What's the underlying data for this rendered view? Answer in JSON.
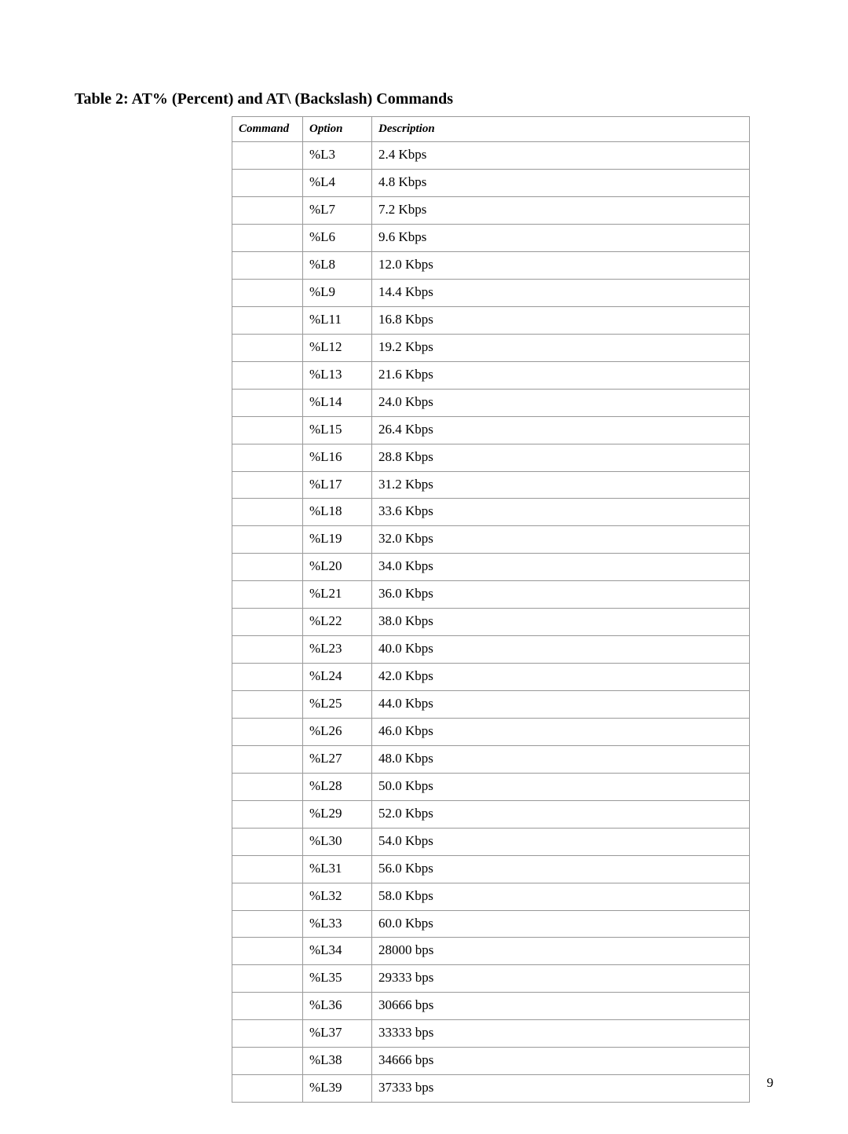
{
  "title": "Table 2: AT% (Percent) and AT\\ (Backslash) Commands",
  "headers": {
    "command": "Command",
    "option": "Option",
    "description": "Description"
  },
  "rows": [
    {
      "command": "",
      "option": "%L3",
      "description": "2.4 Kbps"
    },
    {
      "command": "",
      "option": "%L4",
      "description": "4.8 Kbps"
    },
    {
      "command": "",
      "option": "%L7",
      "description": "7.2 Kbps"
    },
    {
      "command": "",
      "option": "%L6",
      "description": "9.6 Kbps"
    },
    {
      "command": "",
      "option": "%L8",
      "description": "12.0 Kbps"
    },
    {
      "command": "",
      "option": "%L9",
      "description": "14.4 Kbps"
    },
    {
      "command": "",
      "option": "%L11",
      "description": "16.8 Kbps"
    },
    {
      "command": "",
      "option": "%L12",
      "description": "19.2 Kbps"
    },
    {
      "command": "",
      "option": "%L13",
      "description": "21.6 Kbps"
    },
    {
      "command": "",
      "option": "%L14",
      "description": "24.0 Kbps"
    },
    {
      "command": "",
      "option": "%L15",
      "description": "26.4 Kbps"
    },
    {
      "command": "",
      "option": "%L16",
      "description": "28.8 Kbps"
    },
    {
      "command": "",
      "option": "%L17",
      "description": "31.2 Kbps"
    },
    {
      "command": "",
      "option": "%L18",
      "description": "33.6 Kbps"
    },
    {
      "command": "",
      "option": "%L19",
      "description": "32.0 Kbps"
    },
    {
      "command": "",
      "option": "%L20",
      "description": "34.0 Kbps"
    },
    {
      "command": "",
      "option": "%L21",
      "description": "36.0 Kbps"
    },
    {
      "command": "",
      "option": "%L22",
      "description": "38.0 Kbps"
    },
    {
      "command": "",
      "option": "%L23",
      "description": "40.0 Kbps"
    },
    {
      "command": "",
      "option": "%L24",
      "description": "42.0 Kbps"
    },
    {
      "command": "",
      "option": "%L25",
      "description": "44.0 Kbps"
    },
    {
      "command": "",
      "option": "%L26",
      "description": "46.0 Kbps"
    },
    {
      "command": "",
      "option": "%L27",
      "description": "48.0 Kbps"
    },
    {
      "command": "",
      "option": "%L28",
      "description": "50.0 Kbps"
    },
    {
      "command": "",
      "option": "%L29",
      "description": "52.0 Kbps"
    },
    {
      "command": "",
      "option": "%L30",
      "description": "54.0 Kbps"
    },
    {
      "command": "",
      "option": "%L31",
      "description": "56.0 Kbps"
    },
    {
      "command": "",
      "option": "%L32",
      "description": "58.0 Kbps"
    },
    {
      "command": "",
      "option": "%L33",
      "description": "60.0 Kbps"
    },
    {
      "command": "",
      "option": "%L34",
      "description": "28000 bps"
    },
    {
      "command": "",
      "option": "%L35",
      "description": "29333 bps"
    },
    {
      "command": "",
      "option": "%L36",
      "description": "30666 bps"
    },
    {
      "command": "",
      "option": "%L37",
      "description": "33333 bps"
    },
    {
      "command": "",
      "option": "%L38",
      "description": "34666 bps"
    },
    {
      "command": "",
      "option": "%L39",
      "description": "37333 bps"
    }
  ],
  "page_number": "9"
}
